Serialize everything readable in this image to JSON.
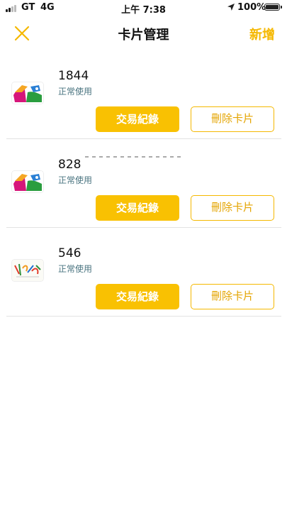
{
  "status_bar": {
    "carrier": "GT",
    "network": "4G",
    "time": "上午 7:38",
    "battery": "100%"
  },
  "nav": {
    "title": "卡片管理",
    "add_label": "新增",
    "close_icon": "close-x-icon"
  },
  "colors": {
    "accent": "#f9c102",
    "status_text": "#4a7480",
    "divider": "#e2e2e2"
  },
  "cards": [
    {
      "number": "1844",
      "status": "正常使用",
      "card_icon": "easycard-icon",
      "history_label": "交易紀錄",
      "delete_label": "刪除卡片"
    },
    {
      "number": "828",
      "status": "正常使用",
      "card_icon": "easycard-icon",
      "history_label": "交易紀錄",
      "delete_label": "刪除卡片"
    },
    {
      "number": "546",
      "status": "正常使用",
      "card_icon": "ipass-card-icon",
      "history_label": "交易紀錄",
      "delete_label": "刪除卡片"
    }
  ]
}
